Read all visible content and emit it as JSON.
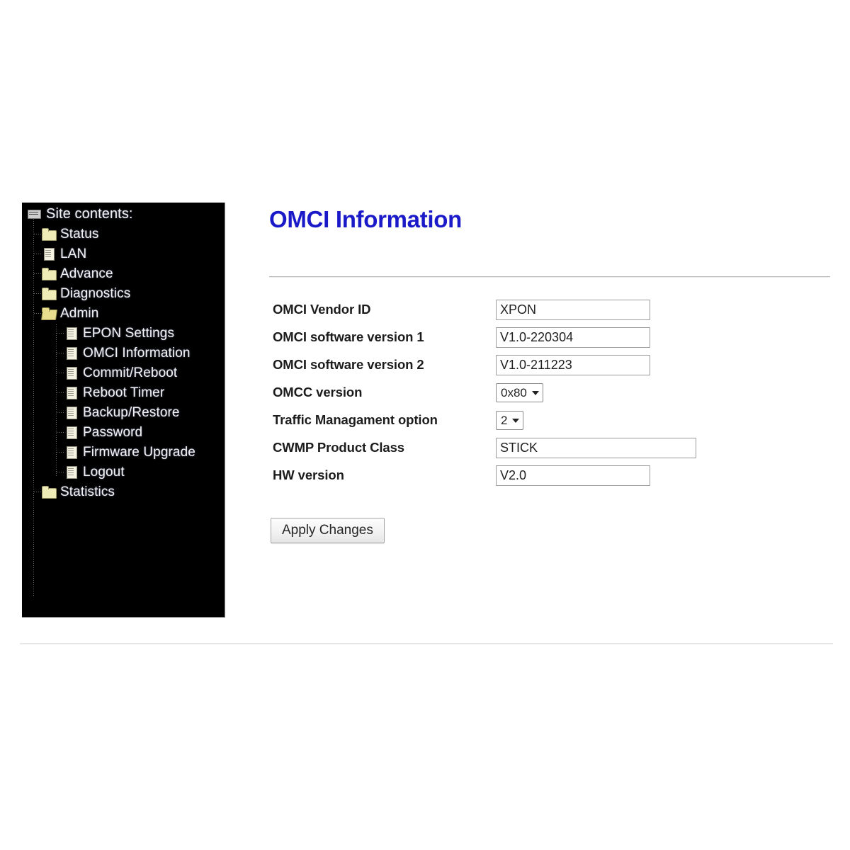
{
  "sidebar": {
    "root_label": "Site contents:",
    "root_icon": "tree-root-icon",
    "items": [
      {
        "label": "Status",
        "icon": "folder-icon",
        "level": 1,
        "type": "folder"
      },
      {
        "label": "LAN",
        "icon": "page-icon",
        "level": 1,
        "type": "file"
      },
      {
        "label": "Advance",
        "icon": "folder-icon",
        "level": 1,
        "type": "folder"
      },
      {
        "label": "Diagnostics",
        "icon": "folder-icon",
        "level": 1,
        "type": "folder"
      },
      {
        "label": "Admin",
        "icon": "folder-open-icon",
        "level": 1,
        "type": "folder-open"
      },
      {
        "label": "EPON Settings",
        "icon": "page-icon",
        "level": 2,
        "type": "file"
      },
      {
        "label": "OMCI Information",
        "icon": "page-icon",
        "level": 2,
        "type": "file"
      },
      {
        "label": "Commit/Reboot",
        "icon": "page-icon",
        "level": 2,
        "type": "file"
      },
      {
        "label": "Reboot Timer",
        "icon": "page-icon",
        "level": 2,
        "type": "file"
      },
      {
        "label": "Backup/Restore",
        "icon": "page-icon",
        "level": 2,
        "type": "file"
      },
      {
        "label": "Password",
        "icon": "page-icon",
        "level": 2,
        "type": "file"
      },
      {
        "label": "Firmware Upgrade",
        "icon": "page-icon",
        "level": 2,
        "type": "file"
      },
      {
        "label": "Logout",
        "icon": "page-icon",
        "level": 2,
        "type": "file"
      },
      {
        "label": "Statistics",
        "icon": "folder-icon",
        "level": 1,
        "type": "folder"
      }
    ]
  },
  "main": {
    "title": "OMCI Information",
    "title_color": "#1a1ac8",
    "fields": [
      {
        "label": "OMCI Vendor ID",
        "value": "XPON",
        "control": "text",
        "width": "std"
      },
      {
        "label": "OMCI software version 1",
        "value": "V1.0-220304",
        "control": "text",
        "width": "std"
      },
      {
        "label": "OMCI software version 2",
        "value": "V1.0-211223",
        "control": "text",
        "width": "std"
      },
      {
        "label": "OMCC version",
        "value": "0x80",
        "control": "select",
        "width": "auto"
      },
      {
        "label": "Traffic Managament option",
        "value": "2",
        "control": "select",
        "width": "auto"
      },
      {
        "label": "CWMP Product Class",
        "value": "STICK",
        "control": "text",
        "width": "wide"
      },
      {
        "label": "HW version",
        "value": "V2.0",
        "control": "text",
        "width": "std"
      }
    ],
    "apply_label": "Apply Changes"
  }
}
